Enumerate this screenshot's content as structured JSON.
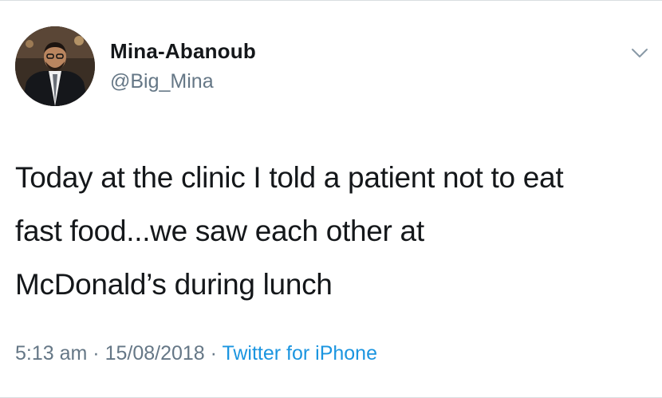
{
  "tweet": {
    "author": {
      "display_name": "Mina-Abanoub",
      "handle": "@Big_Mina",
      "avatar_icon": "profile-photo"
    },
    "menu_icon": "chevron-down-icon",
    "text_lines": [
      "Today at the clinic I told a patient not to eat",
      "fast food...we saw each other at",
      "McDonald’s during lunch"
    ],
    "meta": {
      "time": "5:13 am",
      "separator": " · ",
      "date": "15/08/2018",
      "source": "Twitter for iPhone"
    }
  },
  "colors": {
    "text": "#14171a",
    "secondary": "#657786",
    "link": "#1b95e0",
    "divider": "#d9dde0"
  }
}
